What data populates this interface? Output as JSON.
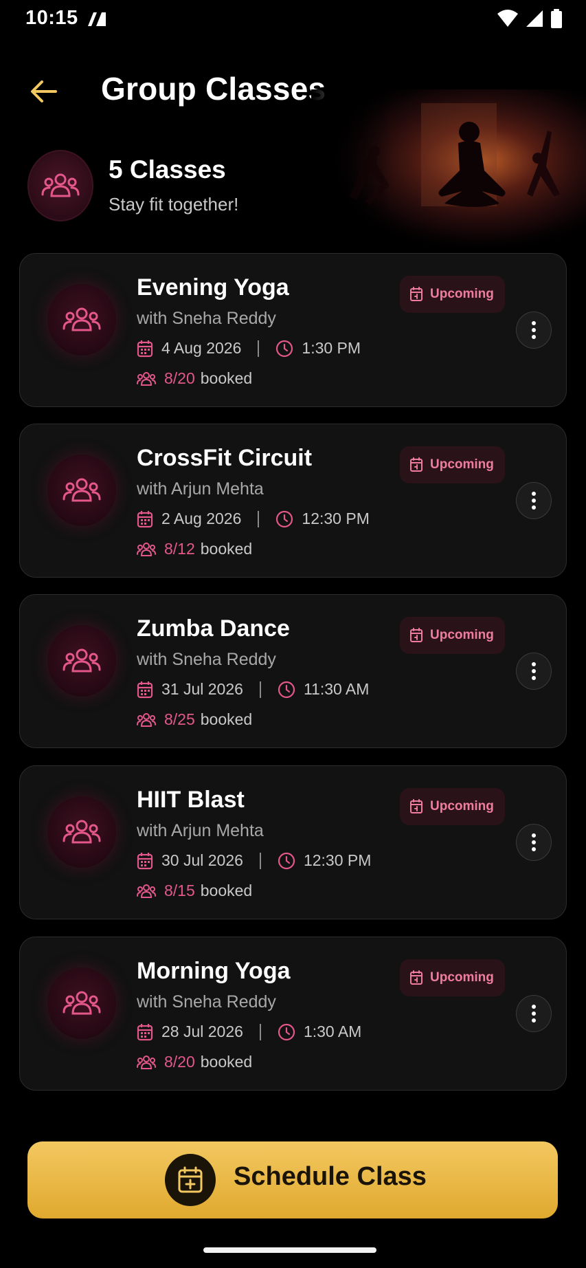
{
  "status_bar": {
    "time": "10:15"
  },
  "header": {
    "title": "Group Classes"
  },
  "hero": {
    "count_label": "5 Classes",
    "subtitle": "Stay fit together!"
  },
  "colors": {
    "accent_pink": "#e4578a",
    "accent_gold": "#e8b23a",
    "card_bg": "#121212"
  },
  "classes": [
    {
      "title": "Evening Yoga",
      "instructor": "with Sneha Reddy",
      "date": "4 Aug 2026",
      "time": "1:30 PM",
      "booked": "8/20",
      "booked_label": "booked",
      "status": "Upcoming"
    },
    {
      "title": "CrossFit Circuit",
      "instructor": "with Arjun Mehta",
      "date": "2 Aug 2026",
      "time": "12:30 PM",
      "booked": "8/12",
      "booked_label": "booked",
      "status": "Upcoming"
    },
    {
      "title": "Zumba Dance",
      "instructor": "with Sneha Reddy",
      "date": "31 Jul 2026",
      "time": "11:30 AM",
      "booked": "8/25",
      "booked_label": "booked",
      "status": "Upcoming"
    },
    {
      "title": "HIIT Blast",
      "instructor": "with Arjun Mehta",
      "date": "30 Jul 2026",
      "time": "12:30 PM",
      "booked": "8/15",
      "booked_label": "booked",
      "status": "Upcoming"
    },
    {
      "title": "Morning Yoga",
      "instructor": "with Sneha Reddy",
      "date": "28 Jul 2026",
      "time": "1:30 AM",
      "booked": "8/20",
      "booked_label": "booked",
      "status": "Upcoming"
    }
  ],
  "schedule_button": {
    "label": "Schedule Class"
  }
}
